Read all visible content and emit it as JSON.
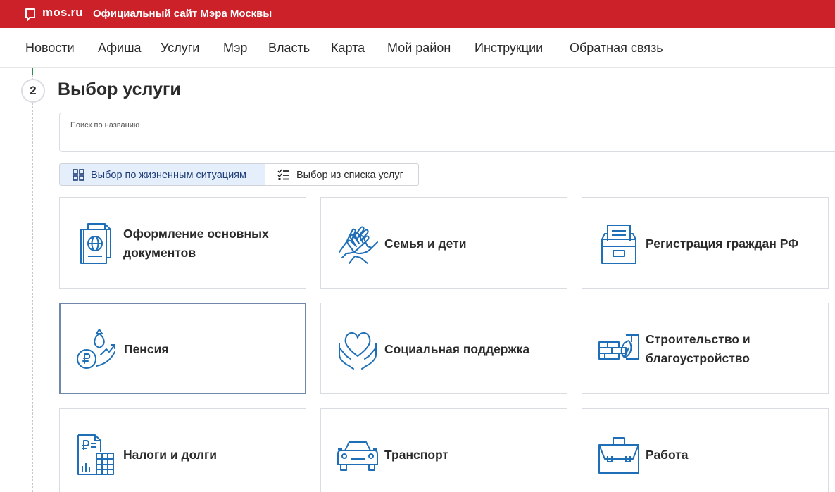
{
  "header": {
    "logo_text": "mos.ru",
    "site_title": "Официальный сайт Мэра Москвы",
    "brand_color": "#cc2128"
  },
  "nav": {
    "items": [
      "Новости",
      "Афиша",
      "Услуги",
      "Мэр",
      "Власть",
      "Карта",
      "Мой район",
      "Инструкции",
      "Обратная связь"
    ]
  },
  "step": {
    "number": "2",
    "title": "Выбор услуги"
  },
  "search": {
    "label": "Поиск по названию",
    "value": ""
  },
  "toggle": {
    "options": [
      {
        "label": "Выбор по жизненным ситуациям",
        "icon": "grid-icon",
        "active": true
      },
      {
        "label": "Выбор из списка услуг",
        "icon": "checklist-icon",
        "active": false
      }
    ]
  },
  "categories": [
    {
      "label_line1": "Оформление основных",
      "label_line2": "документов",
      "icon": "passport-icon",
      "selected": false
    },
    {
      "label_line1": "Семья и дети",
      "label_line2": "",
      "icon": "hands-icon",
      "selected": false
    },
    {
      "label_line1": "Регистрация граждан РФ",
      "label_line2": "",
      "icon": "file-cabinet-icon",
      "selected": false
    },
    {
      "label_line1": "Пенсия",
      "label_line2": "",
      "icon": "pension-money-icon",
      "selected": true
    },
    {
      "label_line1": "Социальная поддержка",
      "label_line2": "",
      "icon": "heart-hands-icon",
      "selected": false
    },
    {
      "label_line1": "Строительство и",
      "label_line2": "благоустройство",
      "icon": "bricks-leaf-icon",
      "selected": false
    },
    {
      "label_line1": "Налоги и долги",
      "label_line2": "",
      "icon": "tax-calculator-icon",
      "selected": false
    },
    {
      "label_line1": "Транспорт",
      "label_line2": "",
      "icon": "car-icon",
      "selected": false
    },
    {
      "label_line1": "Работа",
      "label_line2": "",
      "icon": "briefcase-icon",
      "selected": false
    }
  ],
  "colors": {
    "icon_blue": "#1e6fb8",
    "toggle_active_bg": "#e5eefb",
    "selected_border": "#6f86ad"
  }
}
